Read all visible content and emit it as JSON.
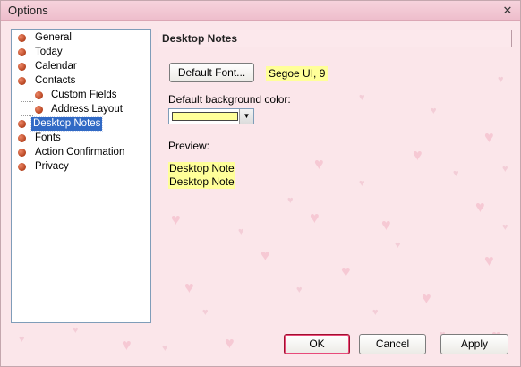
{
  "window": {
    "title": "Options",
    "close_glyph": "✕"
  },
  "tree": {
    "items": [
      {
        "label": "General"
      },
      {
        "label": "Today"
      },
      {
        "label": "Calendar"
      },
      {
        "label": "Contacts"
      },
      {
        "label": "Custom Fields"
      },
      {
        "label": "Address Layout"
      },
      {
        "label": "Desktop Notes",
        "selected": true
      },
      {
        "label": "Fonts"
      },
      {
        "label": "Action Confirmation"
      },
      {
        "label": "Privacy"
      }
    ]
  },
  "panel": {
    "title": "Desktop Notes",
    "default_font_button": "Default Font...",
    "font_sample": "Segoe UI, 9",
    "bg_color_label": "Default background color:",
    "bg_color_value": "#ffff99",
    "preview_label": "Preview:",
    "preview_lines": [
      "Desktop Note",
      "Desktop Note"
    ]
  },
  "buttons": {
    "ok": "OK",
    "cancel": "Cancel",
    "apply": "Apply"
  },
  "colors": {
    "accent": "#316ac5",
    "note_yellow": "#ffff99",
    "background_pink": "#fbe6ea"
  }
}
